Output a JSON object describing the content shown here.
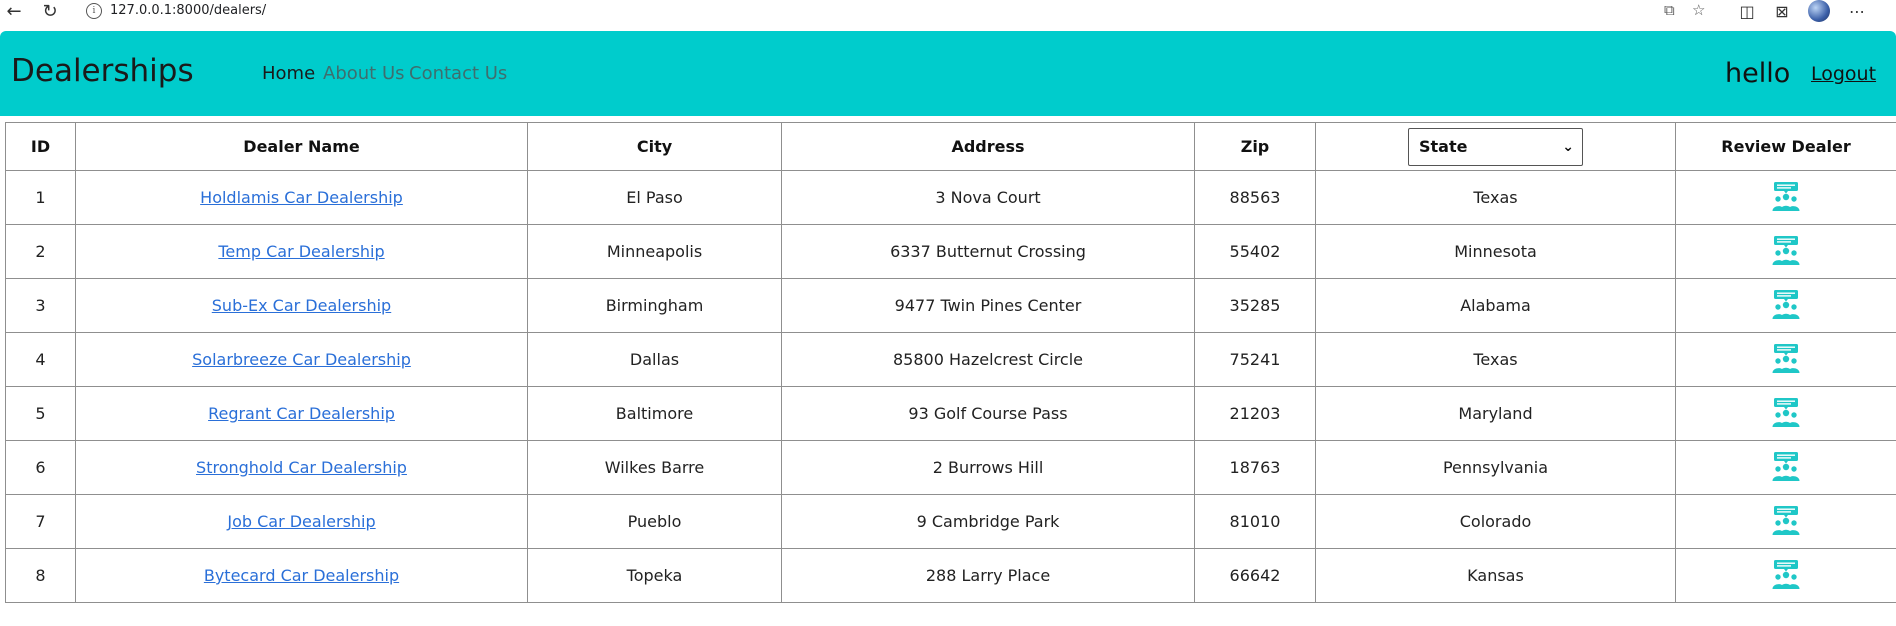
{
  "browser": {
    "url": "127.0.0.1:8000/dealers/"
  },
  "navbar": {
    "brand": "Dealerships",
    "links": [
      {
        "label": "Home"
      },
      {
        "label": "About Us"
      },
      {
        "label": "Contact Us"
      }
    ],
    "username": "hello",
    "logout_label": "Logout",
    "background_color": "#00cccc"
  },
  "table": {
    "headers": {
      "id": "ID",
      "dealer_name": "Dealer Name",
      "city": "City",
      "address": "Address",
      "zip": "Zip",
      "review": "Review Dealer"
    },
    "state_filter": {
      "selected": "State"
    },
    "review_icon": "review-people-icon",
    "rows": [
      {
        "id": "1",
        "name": "Holdlamis Car Dealership",
        "city": "El Paso",
        "address": "3 Nova Court",
        "zip": "88563",
        "state": "Texas"
      },
      {
        "id": "2",
        "name": "Temp Car Dealership",
        "city": "Minneapolis",
        "address": "6337 Butternut Crossing",
        "zip": "55402",
        "state": "Minnesota"
      },
      {
        "id": "3",
        "name": "Sub-Ex Car Dealership",
        "city": "Birmingham",
        "address": "9477 Twin Pines Center",
        "zip": "35285",
        "state": "Alabama"
      },
      {
        "id": "4",
        "name": "Solarbreeze Car Dealership",
        "city": "Dallas",
        "address": "85800 Hazelcrest Circle",
        "zip": "75241",
        "state": "Texas"
      },
      {
        "id": "5",
        "name": "Regrant Car Dealership",
        "city": "Baltimore",
        "address": "93 Golf Course Pass",
        "zip": "21203",
        "state": "Maryland"
      },
      {
        "id": "6",
        "name": "Stronghold Car Dealership",
        "city": "Wilkes Barre",
        "address": "2 Burrows Hill",
        "zip": "18763",
        "state": "Pennsylvania"
      },
      {
        "id": "7",
        "name": "Job Car Dealership",
        "city": "Pueblo",
        "address": "9 Cambridge Park",
        "zip": "81010",
        "state": "Colorado"
      },
      {
        "id": "8",
        "name": "Bytecard Car Dealership",
        "city": "Topeka",
        "address": "288 Larry Place",
        "zip": "66642",
        "state": "Kansas"
      }
    ],
    "accent_color": "#1fc7c7"
  }
}
